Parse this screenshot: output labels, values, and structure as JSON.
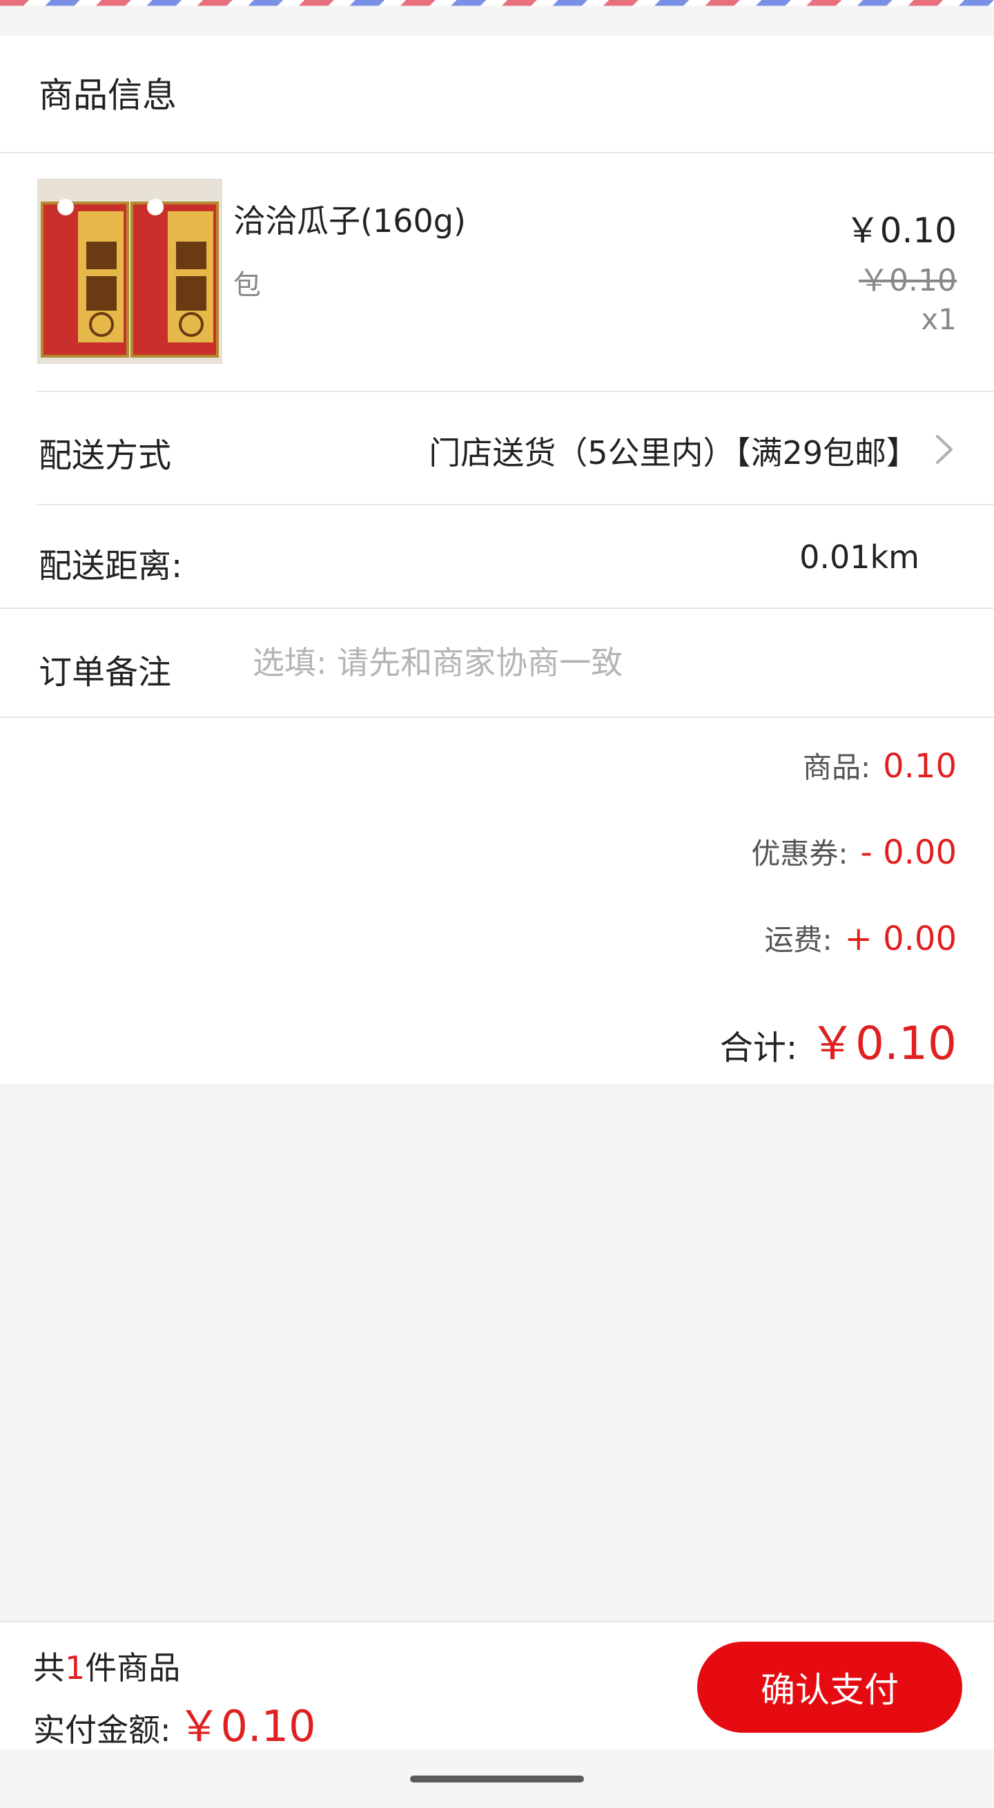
{
  "header": {
    "title": "商品信息"
  },
  "product": {
    "name": "洽洽瓜子(160g)",
    "unit": "包",
    "price": "￥0.10",
    "original_price": "￥0.10",
    "quantity": "x1",
    "image_icon": "product-photo"
  },
  "delivery": {
    "label": "配送方式",
    "value": "门店送货（5公里内）【满29包邮】",
    "chevron_icon": "chevron-right-icon"
  },
  "distance": {
    "label": "配送距离:",
    "value": "0.01km"
  },
  "remark": {
    "label": "订单备注",
    "placeholder": "选填: 请先和商家协商一致",
    "value": ""
  },
  "summary": {
    "goods_label": "商品:",
    "goods_value": "0.10",
    "coupon_label": "优惠券:",
    "coupon_value": "- 0.00",
    "shipping_label": "运费:",
    "shipping_value": "+ 0.00",
    "total_label": "合计:",
    "total_value": "￥0.10"
  },
  "footer": {
    "count_prefix": "共",
    "count_value": "1",
    "count_suffix": "件商品",
    "pay_label": "实付金额:",
    "pay_value": "￥0.10",
    "confirm_label": "确认支付"
  },
  "colors": {
    "accent": "#e60b11",
    "price_red": "#e02020",
    "background": "#f5f5f5"
  }
}
